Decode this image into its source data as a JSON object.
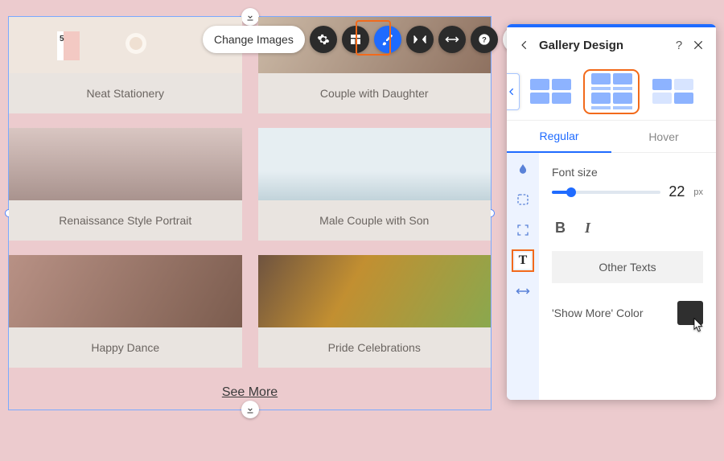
{
  "toolbar": {
    "change_images": "Change Images"
  },
  "gallery": {
    "items": [
      {
        "caption": "Neat Stationery"
      },
      {
        "caption": "Couple with Daughter"
      },
      {
        "caption": "Renaissance Style Portrait"
      },
      {
        "caption": "Male Couple with Son"
      },
      {
        "caption": "Happy Dance"
      },
      {
        "caption": "Pride Celebrations"
      }
    ],
    "see_more": "See More"
  },
  "panel": {
    "title": "Gallery Design",
    "tabs": {
      "regular": "Regular",
      "hover": "Hover"
    },
    "font_size_label": "Font size",
    "font_size_value": "22",
    "font_size_unit": "px",
    "other_texts": "Other Texts",
    "show_more_color_label": "'Show More' Color",
    "show_more_color": "#2f2f2f"
  }
}
